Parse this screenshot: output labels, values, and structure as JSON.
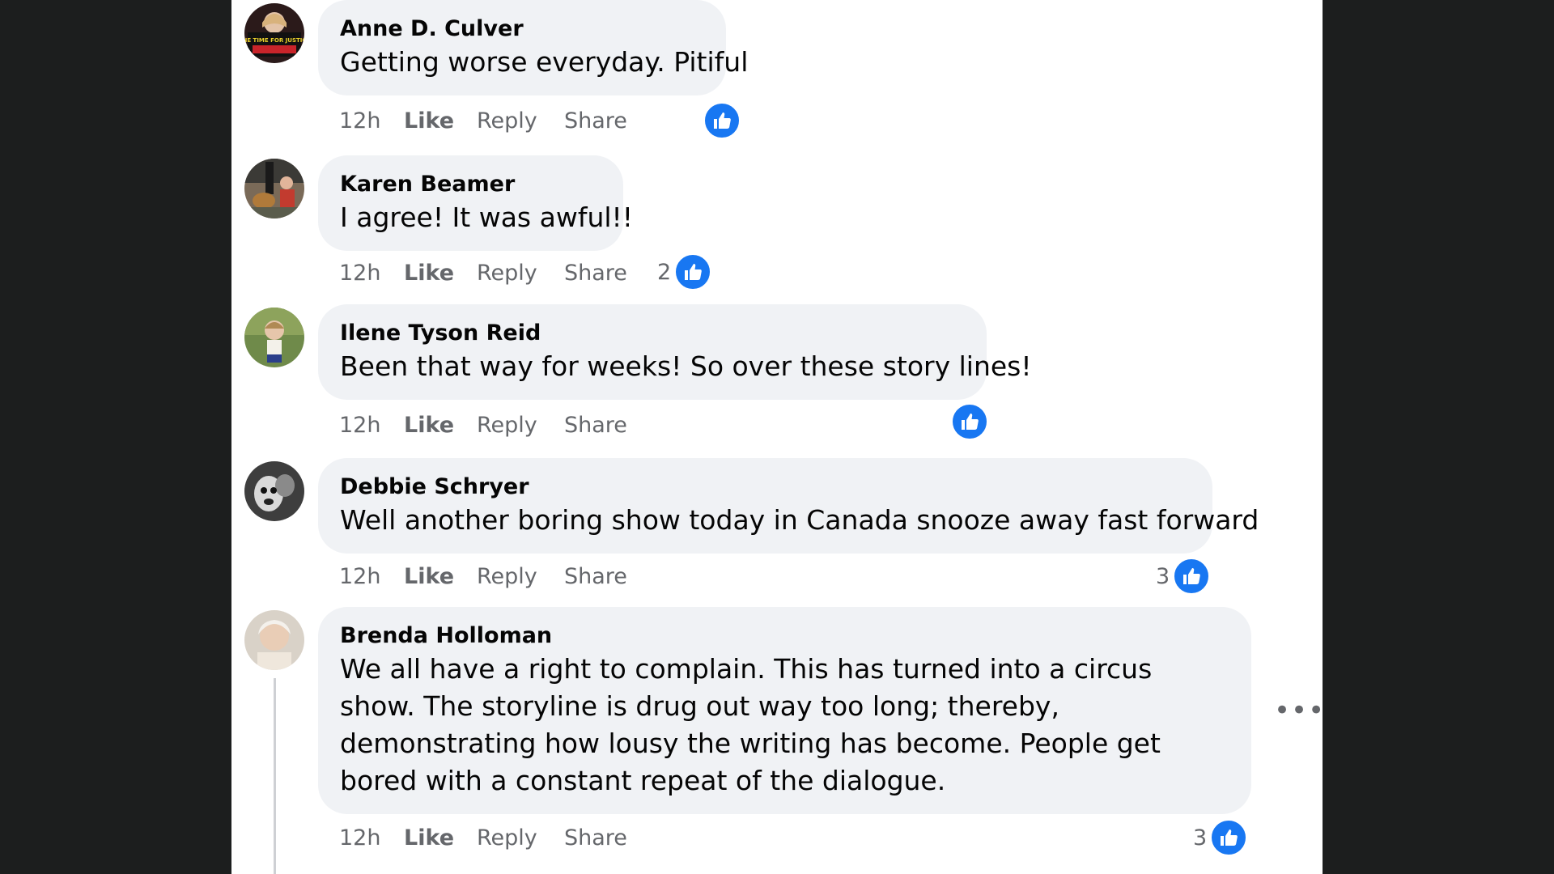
{
  "comments": [
    {
      "author": "Anne D. Culver",
      "text": "Getting worse everyday. Pitiful",
      "time": "12h",
      "like_label": "Like",
      "reply_label": "Reply",
      "share_label": "Share",
      "reaction_count": "",
      "avatar_text": "THE TIME FOR JUSTICE"
    },
    {
      "author": "Karen Beamer",
      "text": "I agree! It was awful!!",
      "time": "12h",
      "like_label": "Like",
      "reply_label": "Reply",
      "share_label": "Share",
      "reaction_count": "2"
    },
    {
      "author": "Ilene Tyson Reid",
      "text": "Been that way for weeks! So over these story lines!",
      "time": "12h",
      "like_label": "Like",
      "reply_label": "Reply",
      "share_label": "Share",
      "reaction_count": ""
    },
    {
      "author": "Debbie Schryer",
      "text": "Well another boring show today in Canada snooze away fast forward",
      "time": "12h",
      "like_label": "Like",
      "reply_label": "Reply",
      "share_label": "Share",
      "reaction_count": "3"
    },
    {
      "author": "Brenda Holloman",
      "text": "We all have a right to complain. This has turned into a circus show. The storyline is drug out way too long; thereby, demonstrating how lousy the writing has become. People get bored with a constant repeat of the dialogue.",
      "time": "12h",
      "like_label": "Like",
      "reply_label": "Reply",
      "share_label": "Share",
      "reaction_count": "3",
      "more_label": "•••"
    }
  ],
  "colors": {
    "page_background": "#1c1e1e",
    "panel_background": "#ffffff",
    "bubble_background": "#f0f2f5",
    "like_blue": "#1877f2",
    "secondary_text": "#65676b"
  },
  "icons": [
    "like-reaction-icon",
    "more-options-icon"
  ]
}
